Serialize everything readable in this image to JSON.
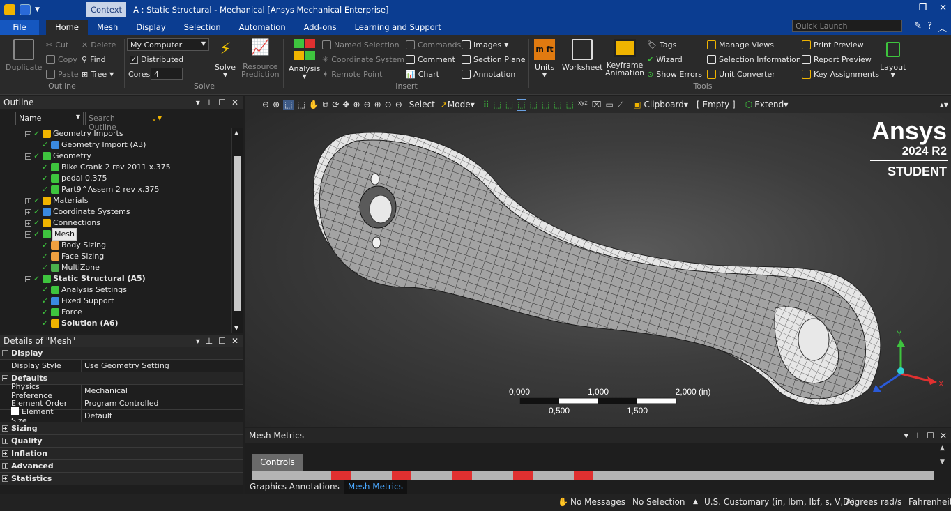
{
  "titlebar": {
    "context": "Context",
    "title": "A : Static Structural - Mechanical [Ansys Mechanical Enterprise]"
  },
  "menu_tabs": [
    "File",
    "Home",
    "Mesh",
    "Display",
    "Selection",
    "Automation",
    "Add-ons",
    "Learning and Support"
  ],
  "quick_launch_placeholder": "Quick Launch",
  "ribbon": {
    "outline_group": {
      "label": "Outline",
      "duplicate": "Duplicate",
      "cut": "Cut",
      "copy": "Copy",
      "paste": "Paste",
      "delete": "Delete",
      "find": "Find",
      "tree": "Tree"
    },
    "solve_group": {
      "label": "Solve",
      "computer": "My Computer",
      "distributed": "Distributed",
      "cores_label": "Cores",
      "cores_value": "4",
      "solve": "Solve",
      "resource": "Resource",
      "prediction": "Prediction"
    },
    "insert_group": {
      "label": "Insert",
      "analysis": "Analysis",
      "named_selection": "Named Selection",
      "coordinate_system": "Coordinate System",
      "remote_point": "Remote Point",
      "commands": "Commands",
      "comment": "Comment",
      "chart": "Chart",
      "images": "Images",
      "section_plane": "Section Plane",
      "annotation": "Annotation"
    },
    "tools_group": {
      "label": "Tools",
      "units": "Units",
      "worksheet": "Worksheet",
      "keyframe": "Keyframe",
      "animation": "Animation",
      "tags": "Tags",
      "wizard": "Wizard",
      "show_errors": "Show Errors",
      "manage_views": "Manage Views",
      "selection_information": "Selection Information",
      "unit_converter": "Unit Converter",
      "print_preview": "Print Preview",
      "report_preview": "Report Preview",
      "key_assignments": "Key Assignments"
    },
    "layout_group": {
      "label": "Layout"
    }
  },
  "outline": {
    "title": "Outline",
    "name_filter": "Name",
    "search_placeholder": "Search Outline",
    "rows": [
      {
        "label": "Geometry Imports",
        "indent": 0,
        "bold": false
      },
      {
        "label": "Geometry Import (A3)",
        "indent": 1,
        "bold": false
      },
      {
        "label": "Geometry",
        "indent": 0,
        "bold": false
      },
      {
        "label": "Bike Crank 2 rev 2011 x.375",
        "indent": 1,
        "bold": false
      },
      {
        "label": "pedal 0.375",
        "indent": 1,
        "bold": false
      },
      {
        "label": "Part9^Assem 2 rev x.375",
        "indent": 1,
        "bold": false
      },
      {
        "label": "Materials",
        "indent": 0,
        "bold": false
      },
      {
        "label": "Coordinate Systems",
        "indent": 0,
        "bold": false
      },
      {
        "label": "Connections",
        "indent": 0,
        "bold": false
      },
      {
        "label": "Mesh",
        "indent": 0,
        "bold": false,
        "selected": true
      },
      {
        "label": "Body Sizing",
        "indent": 1,
        "bold": false
      },
      {
        "label": "Face Sizing",
        "indent": 1,
        "bold": false
      },
      {
        "label": "MultiZone",
        "indent": 1,
        "bold": false
      },
      {
        "label": "Static Structural (A5)",
        "indent": 0,
        "bold": true
      },
      {
        "label": "Analysis Settings",
        "indent": 1,
        "bold": false
      },
      {
        "label": "Fixed Support",
        "indent": 1,
        "bold": false
      },
      {
        "label": "Force",
        "indent": 1,
        "bold": false
      },
      {
        "label": "Solution (A6)",
        "indent": 1,
        "bold": true
      }
    ]
  },
  "details": {
    "title": "Details of \"Mesh\"",
    "rows": [
      {
        "cat": true,
        "sign": "−",
        "k": "Display"
      },
      {
        "k": "Display Style",
        "v": "Use Geometry Setting"
      },
      {
        "cat": true,
        "sign": "−",
        "k": "Defaults"
      },
      {
        "k": "Physics Preference",
        "v": "Mechanical"
      },
      {
        "k": "Element Order",
        "v": "Program Controlled"
      },
      {
        "k": "Element Size",
        "v": "Default",
        "box": true
      },
      {
        "cat": true,
        "sign": "+",
        "k": "Sizing"
      },
      {
        "cat": true,
        "sign": "+",
        "k": "Quality"
      },
      {
        "cat": true,
        "sign": "+",
        "k": "Inflation"
      },
      {
        "cat": true,
        "sign": "+",
        "k": "Advanced"
      },
      {
        "cat": true,
        "sign": "+",
        "k": "Statistics"
      }
    ]
  },
  "view_toolbar": {
    "select": "Select",
    "mode": "Mode",
    "clipboard": "Clipboard",
    "empty": "[ Empty ]",
    "extend": "Extend"
  },
  "watermark": {
    "brand": "Ansys",
    "version": "2024 R2",
    "edition": "STUDENT"
  },
  "scale": {
    "top": [
      "0,000",
      "1,000",
      "2,000 (in)"
    ],
    "bottom": [
      "0,500",
      "1,500"
    ]
  },
  "triad": {
    "x": "X",
    "y": "Y"
  },
  "mesh_metrics": {
    "title": "Mesh Metrics",
    "controls": "Controls",
    "tabs": [
      "Graphics Annotations",
      "Mesh Metrics"
    ]
  },
  "status": {
    "messages": "No Messages",
    "selection": "No Selection",
    "units": "U.S. Customary (in, lbm, lbf, s, V, A)",
    "angle": "Degrees",
    "rate": "rad/s",
    "temp": "Fahrenheit"
  },
  "colors": {
    "brand_blue": "#0b3d91",
    "file_tab": "#1557c0",
    "check_green": "#3ec43e",
    "metric_red": "#e03030"
  }
}
